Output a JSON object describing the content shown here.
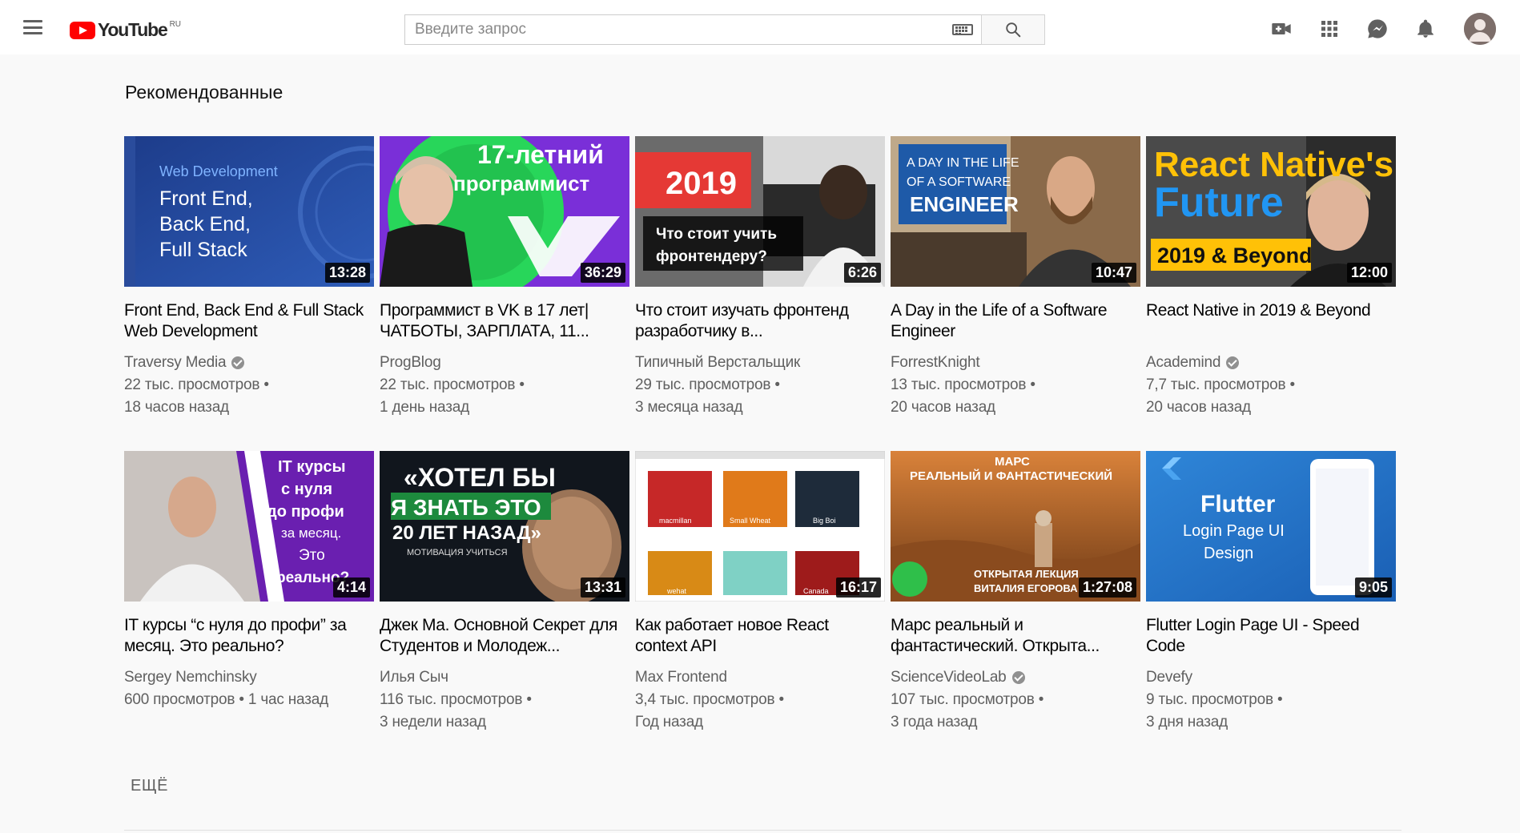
{
  "header": {
    "logo_text": "YouTube",
    "logo_country": "RU",
    "search_placeholder": "Введите запрос",
    "icons": [
      "menu-icon",
      "keyboard-icon",
      "search-icon",
      "create-video-icon",
      "apps-icon",
      "messages-icon",
      "notifications-icon",
      "avatar"
    ]
  },
  "main": {
    "section_title": "Рекомендованные",
    "more_label": "ЕЩЁ",
    "videos": [
      {
        "title": "Front End, Back End & Full Stack Web Development",
        "channel": "Traversy Media",
        "verified": true,
        "views": "22 тыс. просмотров",
        "age": "18 часов назад",
        "duration": "13:28",
        "thumb_text": [
          "Web Development",
          "Front End,",
          "Back End,",
          "Full Stack"
        ]
      },
      {
        "title": "Программист в VK в 17 лет| ЧАТБОТЫ, ЗАРПЛАТА, 11...",
        "channel": "ProgBlog",
        "verified": false,
        "views": "22 тыс. просмотров",
        "age": "1 день назад",
        "duration": "36:29",
        "thumb_text": [
          "17-летний",
          "программист"
        ]
      },
      {
        "title": "Что стоит изучать фронтенд разработчику в...",
        "channel": "Типичный Верстальщик",
        "verified": false,
        "views": "29 тыс. просмотров",
        "age": "3 месяца назад",
        "duration": "6:26",
        "thumb_text": [
          "2019",
          "Что стоит учить",
          "фронтендеру?"
        ]
      },
      {
        "title": "A Day in the Life of a Software Engineer",
        "channel": "ForrestKnight",
        "verified": false,
        "views": "13 тыс. просмотров",
        "age": "20 часов назад",
        "duration": "10:47",
        "thumb_text": [
          "A DAY IN THE LIFE",
          "OF A SOFTWARE",
          "ENGINEER"
        ]
      },
      {
        "title": "React Native in 2019 & Beyond",
        "channel": "Academind",
        "verified": true,
        "views": "7,7 тыс. просмотров",
        "age": "20 часов назад",
        "duration": "12:00",
        "thumb_text": [
          "React Native's",
          "Future",
          "2019 & Beyond"
        ]
      },
      {
        "title": "IT курсы “с нуля до профи” за месяц. Это реально?",
        "channel": "Sergey Nemchinsky",
        "verified": false,
        "views": "600 просмотров",
        "age": "1 час назад",
        "duration": "4:14",
        "thumb_text": [
          "IT курсы",
          "с нуля",
          "до профи",
          "за месяц.",
          "Это",
          "реально?"
        ]
      },
      {
        "title": "Джек Ма. Основной Секрет для Студентов и Молодеж...",
        "channel": "Илья Сыч",
        "verified": false,
        "views": "116 тыс. просмотров",
        "age": "3 недели назад",
        "duration": "13:31",
        "thumb_text": [
          "«ХОТЕЛ БЫ",
          "Я ЗНАТЬ ЭТО",
          "20 ЛЕТ НАЗАД»",
          "МОТИВАЦИЯ УЧИТЬСЯ"
        ]
      },
      {
        "title": "Как работает новое React context API",
        "channel": "Max Frontend",
        "verified": false,
        "views": "3,4 тыс. просмотров",
        "age": "Год назад",
        "duration": "16:17",
        "thumb_text": [
          "macmillan",
          "Small Wheat",
          "Big Boi",
          "wehat",
          "Canada"
        ]
      },
      {
        "title": "Марс реальный и фантастический. Открыта...",
        "channel": "ScienceVideoLab",
        "verified": true,
        "views": "107 тыс. просмотров",
        "age": "3 года назад",
        "duration": "1:27:08",
        "thumb_text": [
          "МАРС",
          "РЕАЛЬНЫЙ И ФАНТАСТИЧЕСКИЙ",
          "ОТКРЫТАЯ ЛЕКЦИЯ",
          "ВИТАЛИЯ ЕГОРОВА"
        ]
      },
      {
        "title": "Flutter Login Page UI - Speed Code",
        "channel": "Devefy",
        "verified": false,
        "views": "9 тыс. просмотров",
        "age": "3 дня назад",
        "duration": "9:05",
        "thumb_text": [
          "Flutter",
          "Login Page UI",
          "Design"
        ]
      }
    ]
  },
  "colors": {
    "brand_red": "#ff0000",
    "page_bg": "#f9f9f9",
    "text_primary": "#030303",
    "text_secondary": "#606060"
  }
}
